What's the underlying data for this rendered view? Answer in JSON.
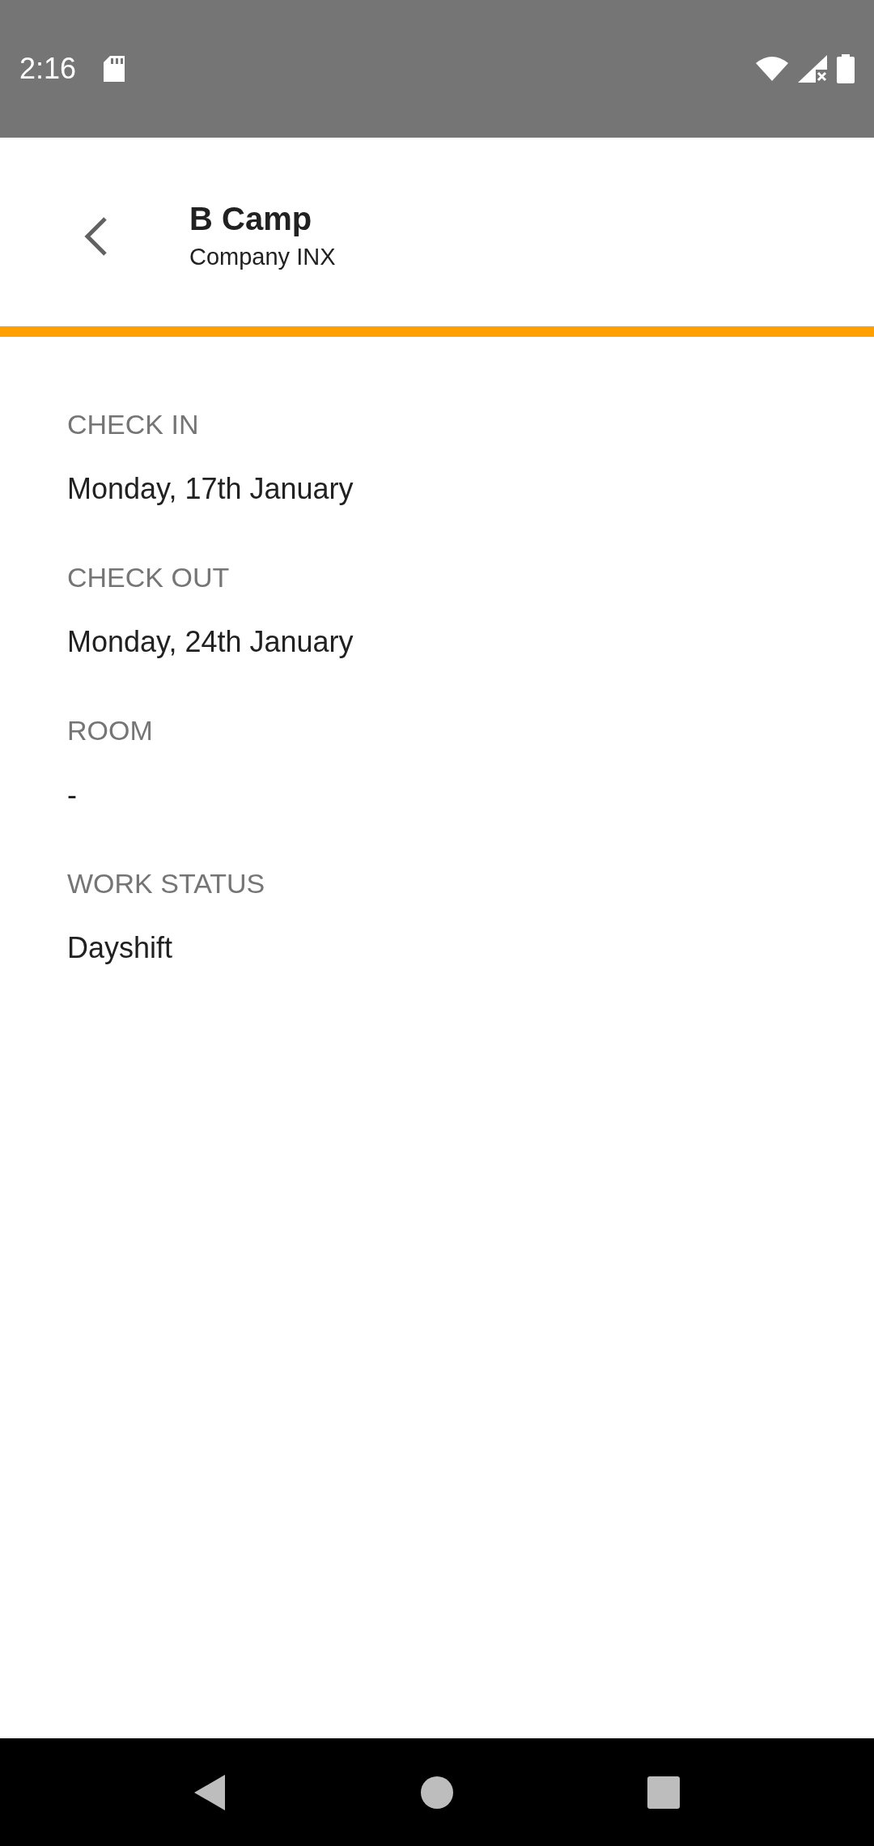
{
  "status_bar": {
    "time": "2:16"
  },
  "header": {
    "title": "B Camp",
    "subtitle": "Company INX"
  },
  "details": [
    {
      "label": "CHECK IN",
      "value": "Monday, 17th January"
    },
    {
      "label": "CHECK OUT",
      "value": "Monday, 24th January"
    },
    {
      "label": "ROOM",
      "value": "-"
    },
    {
      "label": "WORK STATUS",
      "value": "Dayshift"
    }
  ]
}
